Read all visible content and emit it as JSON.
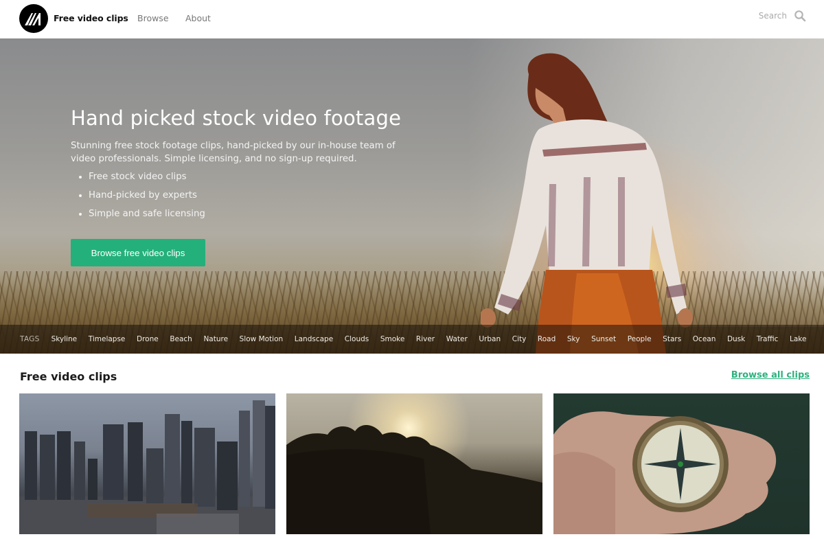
{
  "header": {
    "brand": "Free video clips",
    "nav": [
      {
        "label": "Browse"
      },
      {
        "label": "About"
      }
    ],
    "search": {
      "placeholder": "Search",
      "value": ""
    },
    "icons": {
      "logo": "m-logo-icon",
      "search": "search-icon"
    }
  },
  "hero": {
    "title": "Hand picked stock video footage",
    "description": "Stunning free stock footage clips, hand-picked by our in-house team of video professionals. Simple licensing, and no sign-up required.",
    "bullets": [
      "Free stock video clips",
      "Hand-picked by experts",
      "Simple and safe licensing"
    ],
    "cta_label": "Browse free video clips",
    "cta_color": "#24b07a"
  },
  "tags": {
    "label": "TAGS",
    "items": [
      "Skyline",
      "Timelapse",
      "Drone",
      "Beach",
      "Nature",
      "Slow Motion",
      "Landscape",
      "Clouds",
      "Smoke",
      "River",
      "Water",
      "Urban",
      "City",
      "Road",
      "Sky",
      "Sunset",
      "People",
      "Stars",
      "Ocean",
      "Dusk",
      "Traffic",
      "Lake"
    ]
  },
  "clips_section": {
    "title": "Free video clips",
    "browse_all_label": "Browse all clips",
    "accent_color": "#2cb27f",
    "clips": [
      {
        "subject": "city skyline at dusk"
      },
      {
        "subject": "sun over forest treetops"
      },
      {
        "subject": "hand holding compass"
      }
    ]
  }
}
